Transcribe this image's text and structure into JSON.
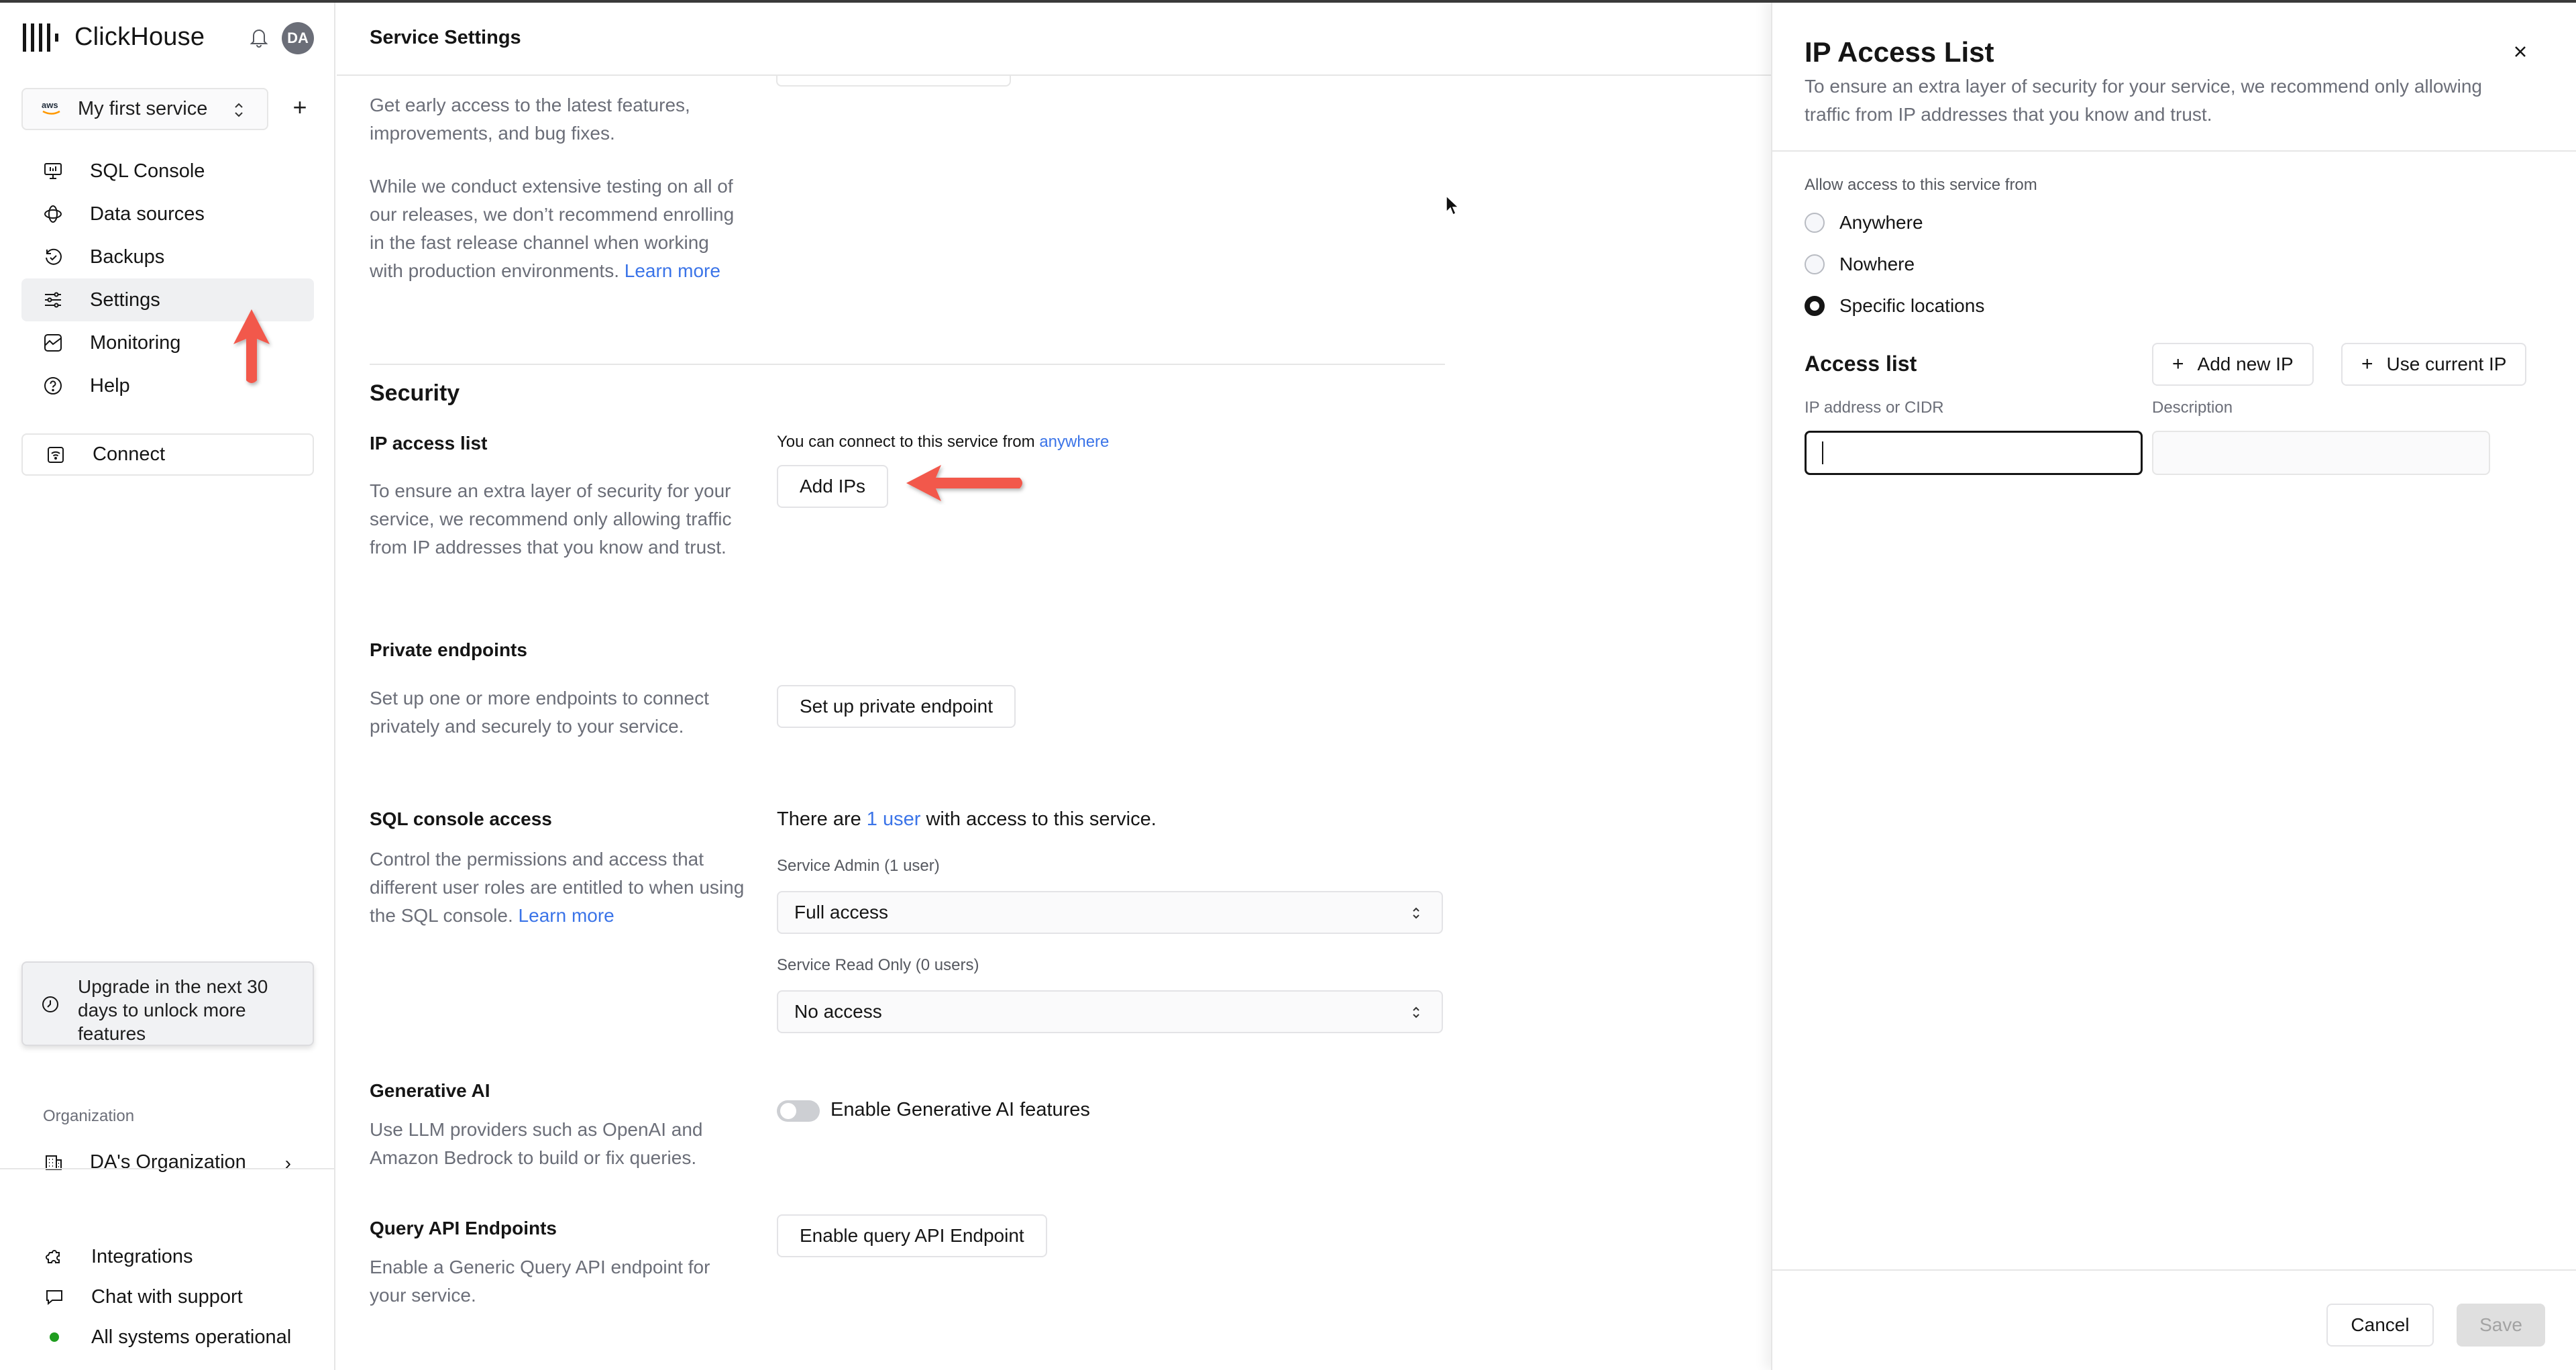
{
  "app": {
    "name": "ClickHouse",
    "avatar_initials": "DA"
  },
  "sidebar": {
    "service_selector": {
      "provider_badge": "aws",
      "label": "My first service"
    },
    "items": [
      {
        "label": "SQL Console",
        "icon": "monitor-icon",
        "active": false
      },
      {
        "label": "Data sources",
        "icon": "data-sources-icon",
        "active": false
      },
      {
        "label": "Backups",
        "icon": "backup-icon",
        "active": false
      },
      {
        "label": "Settings",
        "icon": "sliders-icon",
        "active": true
      },
      {
        "label": "Monitoring",
        "icon": "chart-icon",
        "active": false
      },
      {
        "label": "Help",
        "icon": "help-icon",
        "active": false
      }
    ],
    "connect_label": "Connect",
    "upgrade_notice": "Upgrade in the next 30 days to unlock more features",
    "organization_label": "Organization",
    "organization_name": "DA's Organization",
    "footer": [
      {
        "label": "Integrations",
        "icon": "puzzle-icon"
      },
      {
        "label": "Chat with support",
        "icon": "chat-icon"
      },
      {
        "label": "All systems operational",
        "icon": "status-dot-icon"
      }
    ],
    "status_color": "#1f9d1f"
  },
  "main": {
    "title": "Service Settings",
    "release_channel": {
      "desc1": "Get early access to the latest features, improvements, and bug fixes.",
      "desc2": "While we conduct extensive testing on all of our releases, we don’t recommend enrolling in the fast release channel when working with production environments.",
      "learn_more": "Learn more"
    },
    "security_heading": "Security",
    "ip_access": {
      "title": "IP access list",
      "desc": "To ensure an extra layer of security for your service, we recommend only allowing traffic from IP addresses that you know and trust.",
      "status_prefix": "You can connect to this service from",
      "status_link": "anywhere",
      "button": "Add IPs"
    },
    "private_endpoints": {
      "title": "Private endpoints",
      "desc": "Set up one or more endpoints to connect privately and securely to your service.",
      "button": "Set up private endpoint"
    },
    "sql_console_access": {
      "title": "SQL console access",
      "desc": "Control the permissions and access that different user roles are entitled to when using the SQL console.",
      "learn_more": "Learn more",
      "users_prefix": "There are",
      "users_link": "1 user",
      "users_suffix": "with access to this service.",
      "admin_label": "Service Admin (1 user)",
      "admin_value": "Full access",
      "readonly_label": "Service Read Only (0 users)",
      "readonly_value": "No access"
    },
    "generative_ai": {
      "title": "Generative AI",
      "desc": "Use LLM providers such as OpenAI and Amazon Bedrock to build or fix queries.",
      "toggle_label": "Enable Generative AI features",
      "enabled": false
    },
    "query_api": {
      "title": "Query API Endpoints",
      "desc": "Enable a Generic Query API endpoint for your service.",
      "button": "Enable query API Endpoint"
    },
    "link_color": "#3b74e8",
    "annotation_color": "#f2584b"
  },
  "panel": {
    "title": "IP Access List",
    "description": "To ensure an extra layer of security for your service, we recommend only allowing traffic from IP addresses that you know and trust.",
    "allow_label": "Allow access to this service from",
    "options": [
      {
        "label": "Anywhere",
        "selected": false
      },
      {
        "label": "Nowhere",
        "selected": false
      },
      {
        "label": "Specific locations",
        "selected": true
      }
    ],
    "access_list_title": "Access list",
    "add_new_ip": "Add new IP",
    "use_current_ip": "Use current IP",
    "ip_field_label": "IP address or CIDR",
    "ip_field_value": "",
    "description_field_label": "Description",
    "description_field_value": "",
    "cancel": "Cancel",
    "save": "Save"
  }
}
